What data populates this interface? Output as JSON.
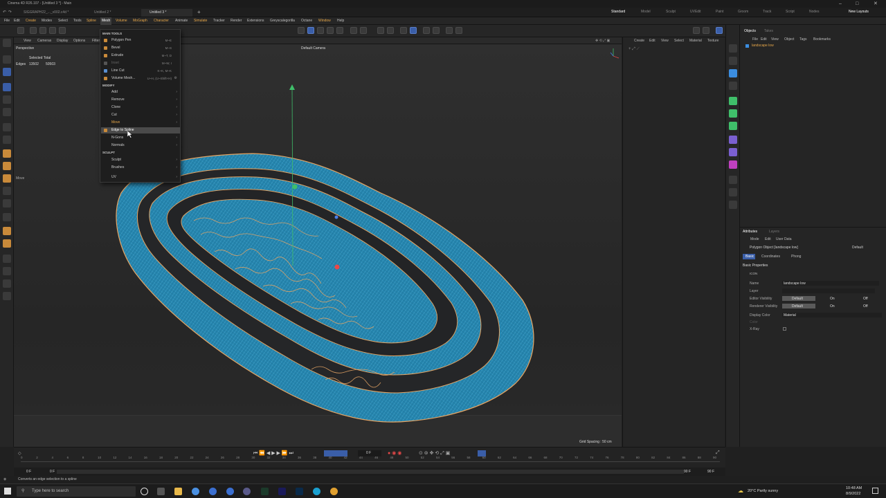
{
  "titlebar": {
    "title": "Cinema 4D R26.107 - [Untitled 3 *] - Main"
  },
  "tabs": [
    {
      "label": "SIGGRAPH22_..._v002.c4d *"
    },
    {
      "label": "Untitled 2 *"
    },
    {
      "label": "Untitled 3 *"
    }
  ],
  "layouts": [
    "Standard",
    "Model",
    "Sculpt",
    "UVEdit",
    "Paint",
    "Groom",
    "Track",
    "Script",
    "Nodes"
  ],
  "new_layouts": "New Layouts",
  "menu": [
    "File",
    "Edit",
    "Create",
    "Modes",
    "Select",
    "Tools",
    "Spline",
    "Mesh",
    "Volume",
    "MoGraph",
    "Character",
    "Animate",
    "Simulate",
    "Tracker",
    "Render",
    "Extensions",
    "Greyscalegorilla",
    "Octane",
    "Window",
    "Help"
  ],
  "viewport_menu": [
    "View",
    "Cameras",
    "Display",
    "Options",
    "Filter"
  ],
  "viewport": {
    "name": "Perspective",
    "camera": "Default Camera",
    "selected_total_label": "Selected Total",
    "edges_label": "Edges",
    "edges_selected": "13502",
    "edges_total": "50503",
    "grid_spacing": "Grid Spacing : 50 cm",
    "move_label": "Move"
  },
  "context_menu": {
    "main_tools_header": "MAIN TOOLS",
    "main_tools": [
      {
        "label": "Polygon Pen",
        "shortcut": "M~E",
        "icon_color": "#c98a3a"
      },
      {
        "label": "Bevel",
        "shortcut": "M~S",
        "icon_color": "#c98a3a"
      },
      {
        "label": "Extrude",
        "shortcut": "M~T, D",
        "icon_color": "#c98a3a"
      },
      {
        "label": "Inset",
        "shortcut": "M~W, I",
        "icon_color": "#666",
        "disabled": true
      },
      {
        "label": "Line Cut",
        "shortcut": "K~K, M~K",
        "icon_color": "#5a8fd0"
      },
      {
        "label": "Volume Mesh...",
        "shortcut": "U~H, (U~Shift+H)",
        "icon_color": "#c98a3a"
      }
    ],
    "modify_header": "MODIFY",
    "modify": [
      "Add",
      "Remove",
      "Clone",
      "Cut",
      "Move",
      "Edge to Spline",
      "N-Gons",
      "Normals"
    ],
    "sculpt_header": "SCULPT",
    "sculpt": [
      "Sculpt",
      "Brushes"
    ],
    "uv": "UV"
  },
  "mid_panel_menu": [
    "Create",
    "Edit",
    "View",
    "Select",
    "Material",
    "Texture"
  ],
  "objects_panel": {
    "tabs": [
      "Objects",
      "Takes"
    ],
    "menu": [
      "File",
      "Edit",
      "View",
      "Object",
      "Tags",
      "Bookmarks"
    ],
    "object_name": "landscape low"
  },
  "attributes": {
    "tabs": [
      "Attributes",
      "Layers"
    ],
    "menu": [
      "Mode",
      "Edit",
      "User Data"
    ],
    "object_title": "Polygon Object [landscape low]",
    "preset": "Default",
    "subtabs": [
      "Basic",
      "Coordinates",
      "Phong"
    ],
    "section": "Basic Properties",
    "icon_label": "ICON",
    "name_label": "Name",
    "name_value": "landscape low",
    "layer_label": "Layer",
    "editor_vis_label": "Editor Visibility",
    "renderer_vis_label": "Renderer Visibility",
    "default": "Default",
    "on": "On",
    "off": "Off",
    "display_color_label": "Display Color",
    "display_color_value": "Material",
    "color_label": "Color",
    "xray_label": "X-Ray"
  },
  "timeline": {
    "current_frame": "0 F",
    "start": "0 F",
    "start2": "0 F",
    "end": "90 F",
    "end2": "90 F",
    "ticks": [
      "0",
      "2",
      "4",
      "6",
      "8",
      "10",
      "12",
      "14",
      "16",
      "18",
      "20",
      "22",
      "24",
      "26",
      "28",
      "30",
      "32",
      "34",
      "36",
      "38",
      "40",
      "42",
      "44",
      "46",
      "48",
      "50",
      "52",
      "54",
      "56",
      "58",
      "60",
      "62",
      "64",
      "66",
      "68",
      "70",
      "72",
      "74",
      "76",
      "78",
      "80",
      "82",
      "84",
      "86",
      "88",
      "90"
    ]
  },
  "statusbar": {
    "text": "Converts an edge selection to a spline"
  },
  "taskbar": {
    "search_placeholder": "Type here to search",
    "weather": "20°C  Partly sunny",
    "time": "10:48 AM",
    "date": "8/9/2022"
  },
  "colors": {
    "accent_orange": "#e8a84a",
    "mesh_blue": "#2e8fb5",
    "mesh_line": "#e0a060",
    "highlight_blue": "#3a5ea8"
  }
}
